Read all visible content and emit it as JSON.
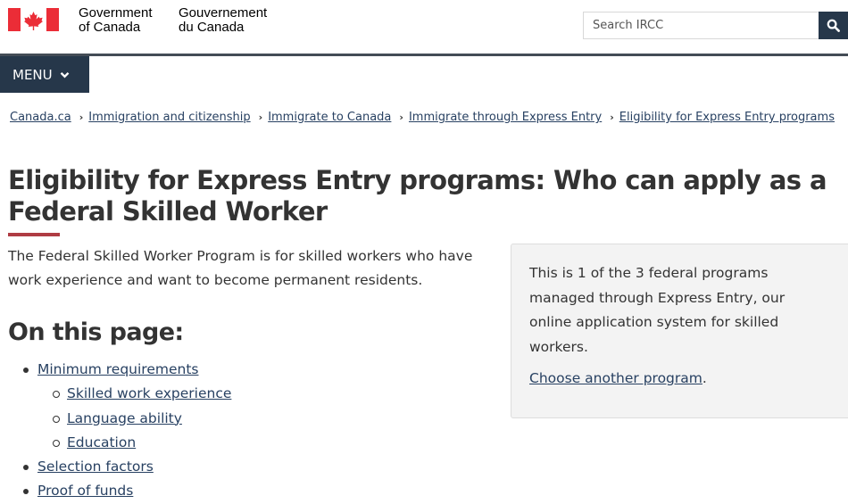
{
  "header": {
    "signature_en_line1": "Government",
    "signature_en_line2": "of Canada",
    "signature_fr_line1": "Gouvernement",
    "signature_fr_line2": "du Canada",
    "search_placeholder": "Search IRCC",
    "search_icon": "search-icon",
    "menu_label": "MENU",
    "menu_icon": "chevron-down-icon"
  },
  "colors": {
    "primary": "#26374a",
    "link": "#284162",
    "accent_red": "#af3c43",
    "flag_red": "#eb2d37"
  },
  "breadcrumb": [
    {
      "label": "Canada.ca"
    },
    {
      "label": "Immigration and citizenship"
    },
    {
      "label": "Immigrate to Canada"
    },
    {
      "label": "Immigrate through Express Entry"
    },
    {
      "label": "Eligibility for Express Entry programs"
    }
  ],
  "main": {
    "title": "Eligibility for Express Entry programs: Who can apply as a Federal Skilled Worker",
    "intro": "The Federal Skilled Worker Program is for skilled workers who have work experience and want to become permanent residents.",
    "aside": {
      "text": "This is 1 of the 3 federal programs managed through Express Entry, our online application system for skilled workers.",
      "link_label": "Choose another program",
      "link_suffix": "."
    },
    "on_this_page": {
      "title": "On this page:",
      "items": [
        {
          "label": "Minimum requirements",
          "level": 1
        },
        {
          "label": "Skilled work experience",
          "level": 2
        },
        {
          "label": "Language ability",
          "level": 2
        },
        {
          "label": "Education",
          "level": 2
        },
        {
          "label": "Selection factors",
          "level": 1
        },
        {
          "label": "Proof of funds",
          "level": 1
        }
      ]
    }
  }
}
